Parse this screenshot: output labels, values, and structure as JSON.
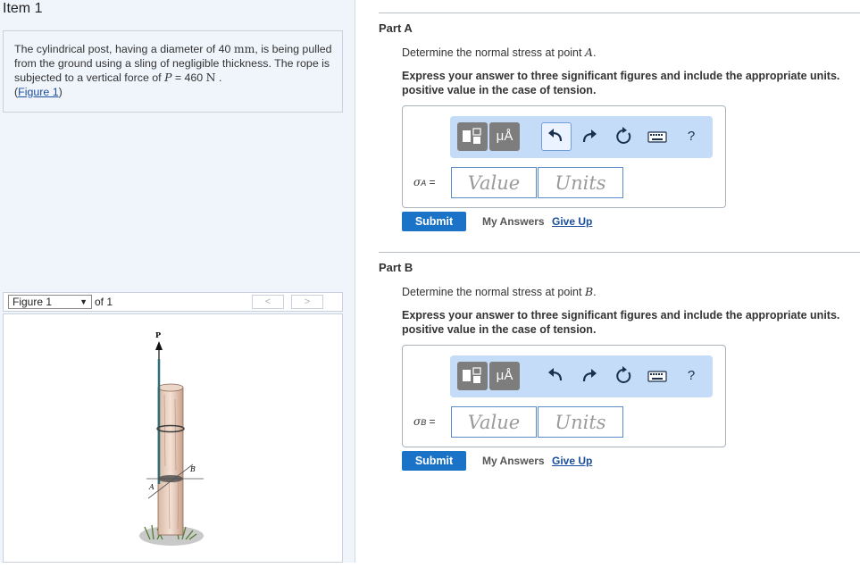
{
  "item": {
    "title": "Item 1"
  },
  "problem": {
    "text_a": "The cylindrical post, having a diameter of 40 ",
    "diameter_unit": "mm",
    "text_b": ", is being pulled from the ground using a sling of negligible thickness. The rope is subjected to a vertical force of ",
    "force_symbol": "P",
    "force_value": " = 460 ",
    "force_unit": "N",
    "text_c": " .",
    "figure_link_open": "(",
    "figure_link": "Figure 1",
    "figure_link_close": ")"
  },
  "figure_nav": {
    "selected": "Figure 1",
    "of_label": "of 1",
    "prev": "<",
    "next": ">"
  },
  "figure": {
    "label_p": "P",
    "label_a": "A",
    "label_b": "B"
  },
  "toolbar": {
    "templates_icon": "templates-icon",
    "units_label": "μÅ",
    "undo_icon": "undo-icon",
    "redo_icon": "redo-icon",
    "reset_icon": "reset-icon",
    "keyboard_icon": "keyboard-icon",
    "help_label": "?"
  },
  "parts": [
    {
      "title": "Part A",
      "question_prefix": "Determine the normal stress at point ",
      "point": "A",
      "question_suffix": ".",
      "instructions": "Express your answer to three significant figures and include the appropriate units. positive value in the case of tension.",
      "symbol": "σ",
      "symbol_sub": "A",
      "equals": " =",
      "value_placeholder": "Value",
      "units_placeholder": "Units",
      "submit_label": "Submit",
      "my_answers_label": "My Answers",
      "give_up_label": "Give Up"
    },
    {
      "title": "Part B",
      "question_prefix": "Determine the normal stress at point ",
      "point": "B",
      "question_suffix": ".",
      "instructions": "Express your answer to three significant figures and include the appropriate units. positive value in the case of tension.",
      "symbol": "σ",
      "symbol_sub": "B",
      "equals": " =",
      "value_placeholder": "Value",
      "units_placeholder": "Units",
      "submit_label": "Submit",
      "my_answers_label": "My Answers",
      "give_up_label": "Give Up"
    }
  ]
}
